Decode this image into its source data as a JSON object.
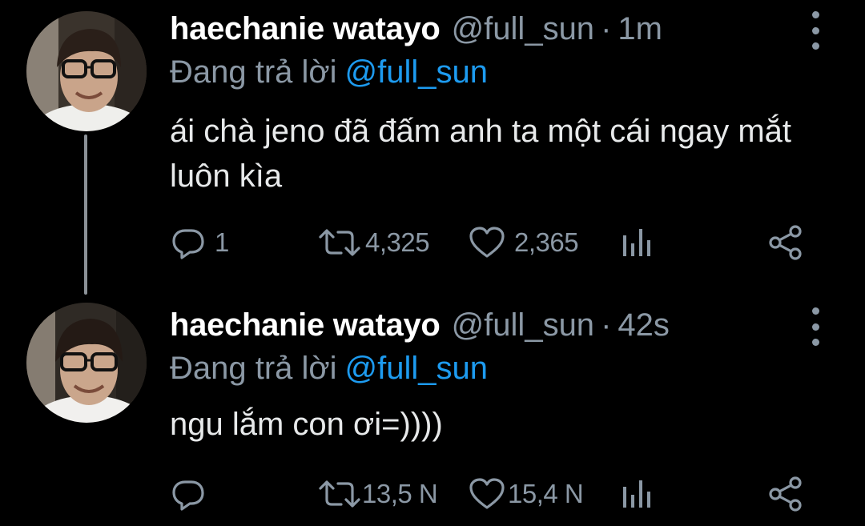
{
  "tweets": [
    {
      "name": "haechanie watayo",
      "handle": "@full_sun",
      "separator": "·",
      "time": "1m",
      "reply_prefix": "Đang trả lời",
      "reply_to": "@full_sun",
      "text": "ái chà jeno đã đấm anh ta một cái ngay mắt luôn kìa",
      "replies": "1",
      "retweets": "4,325",
      "likes": "2,365"
    },
    {
      "name": "haechanie watayo",
      "handle": "@full_sun",
      "separator": "·",
      "time": "42s",
      "reply_prefix": "Đang trả lời",
      "reply_to": "@full_sun",
      "text": "ngu lắm con ơi=))))",
      "replies": "",
      "retweets": "13,5 N",
      "likes": "15,4 N"
    }
  ],
  "icons": {
    "reply": "reply-icon",
    "retweet": "retweet-icon",
    "like": "heart-icon",
    "stats": "analytics-icon",
    "share": "share-icon",
    "more": "more-options-icon"
  },
  "colors": {
    "background": "#000000",
    "text": "#e7e9ea",
    "muted": "#8b98a5",
    "link": "#1d9bf0"
  }
}
